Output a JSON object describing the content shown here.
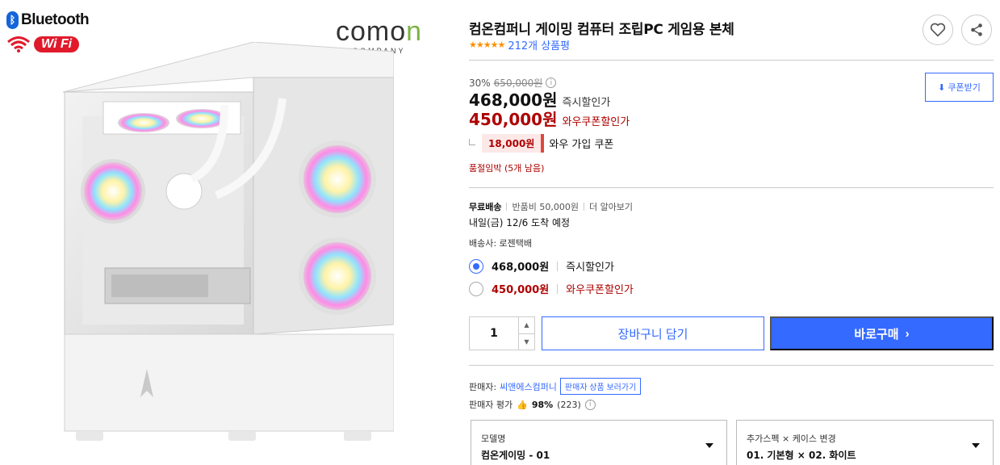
{
  "image": {
    "bluetooth_logo": "Bluetooth",
    "wifi_logo": "Wi Fi",
    "brand_logo_main": "comon",
    "brand_logo_sub": "COMPANY"
  },
  "product": {
    "title": "컴온컴퍼니 게이밍 컴퓨터 조립PC 게임용 본체",
    "stars": "★★★★★",
    "review_count": "212개 상품평"
  },
  "pricing": {
    "discount_rate": "30%",
    "original_price": "650,000원",
    "instant_price": "468,000원",
    "instant_label": "즉시할인가",
    "coupon_price": "450,000원",
    "coupon_label": "와우쿠폰할인가",
    "coupon_button": "쿠폰받기",
    "join_coupon_amount": "18,000원",
    "join_coupon_label": "와우 가입 쿠폰",
    "stock_notice": "품절임박 (5개 남음)"
  },
  "shipping": {
    "free": "무료배송",
    "return_fee": "반품비 50,000원",
    "more": "더 알아보기",
    "arrival": "내일(금) 12/6 도착 예정",
    "carrier": "배송사: 로젠택배"
  },
  "price_options": [
    {
      "price": "468,000원",
      "label": "즉시할인가",
      "selected": true
    },
    {
      "price": "450,000원",
      "label": "와우쿠폰할인가",
      "selected": false
    }
  ],
  "purchase": {
    "quantity": "1",
    "cart_button": "장바구니 담기",
    "buy_button": "바로구매"
  },
  "seller": {
    "label": "판매자:",
    "name": "씨앤에스컴퍼니",
    "seller_products_button": "판매자 상품 보러가기",
    "rating_label": "판매자 평가",
    "rating_value": "98%",
    "rating_count": "(223)"
  },
  "options": [
    {
      "label": "모델명",
      "value": "컴온게이밍 - 01"
    },
    {
      "label": "추가스펙 × 케이스 변경",
      "value": "01. 기본형 × 02. 화이트"
    }
  ],
  "colors": {
    "accent_blue": "#346aff",
    "price_red": "#ae0000",
    "star_orange": "#ff8f00"
  }
}
